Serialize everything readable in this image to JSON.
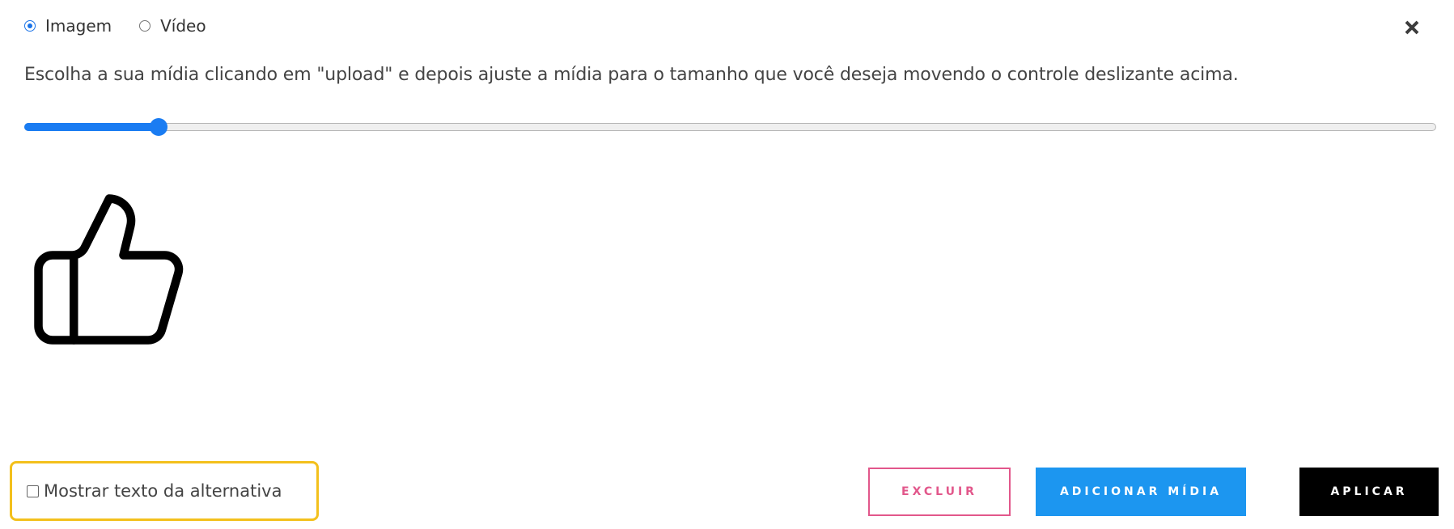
{
  "media_type": {
    "options": [
      {
        "label": "Imagem",
        "checked": true
      },
      {
        "label": "Vídeo",
        "checked": false
      }
    ]
  },
  "close": {
    "icon": "close-icon"
  },
  "instructions": "Escolha a sua mídia clicando em \"upload\" e depois ajuste a mídia para o tamanho que você deseja movendo o controle deslizante acima.",
  "size_slider": {
    "value_fraction": 0.095,
    "accent_color": "#1a7cf2"
  },
  "preview": {
    "icon": "thumbs-up-icon"
  },
  "alt_text": {
    "label": "Mostrar texto da alternativa",
    "checked": false,
    "highlight_color": "#f3c01c"
  },
  "actions": {
    "delete_label": "EXCLUIR",
    "add_media_label": "ADICIONAR MÍDIA",
    "apply_label": "APLICAR",
    "delete_color": "#e2578b",
    "add_media_color": "#1c96f0",
    "apply_color": "#000000"
  }
}
